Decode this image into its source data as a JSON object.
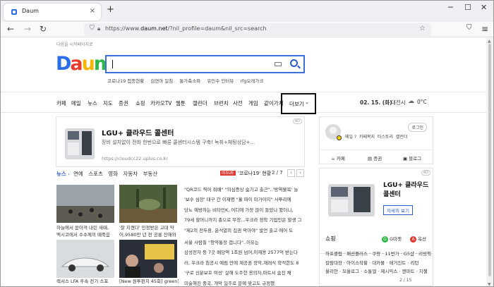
{
  "browser": {
    "tab_title": "Daum",
    "url_prefix": "https://www.",
    "url_domain": "daum.net",
    "url_path": "/?nil_profile=daum&nil_src=search"
  },
  "page": {
    "top_link": "다음을 시작페이지로",
    "logo": {
      "letters": [
        "D",
        "a",
        "u",
        "m"
      ],
      "colors": [
        "#2a6ee8",
        "#e83a2f",
        "#f5b400",
        "#2eb84a"
      ]
    },
    "search": {
      "placeholder": ""
    },
    "trends": [
      "코로나19 접종현황",
      "김연아 일침",
      "통가축소파",
      "유인수 인터뷰",
      "rfg오레가크"
    ],
    "menu": [
      "카페",
      "메일",
      "뉴스",
      "지도",
      "증권",
      "쇼핑",
      "카카오TV",
      "웹툰",
      "캘린더",
      "브런치",
      "사전",
      "게임",
      "같이가치",
      "더보기"
    ],
    "date": "02. 15. (화)",
    "region": "대전시",
    "temperature": "0°C"
  },
  "ad_main": {
    "tag": "AD",
    "title": "LGU+ 클라우드 콜센터",
    "desc": "장비 설치없이 전화 한번으로 빠른 콜센터시스템 구축! 녹취+채팅상담+...",
    "url": "https://cloudcc22.uplus.co.kr"
  },
  "news": {
    "tabs": [
      "뉴스",
      "연예",
      "스포츠",
      "영화",
      "자동차",
      "부동산"
    ],
    "issue_badge": "ISSUE",
    "issue_text": "'코로나19' 현황",
    "page": "2 / 7",
    "photos": [
      {
        "caption1": "하늘에서 쏟아져 내린 새떼,",
        "caption2": "멕시코에서 수수께끼 떼죽음"
      },
      {
        "caption1": "'잘 지켰다' 인정받은 고대 약",
        "caption2": "어,9580만 년 전 공룡 잔해와"
      },
      {
        "caption1": "렉서스 LFA 후속 전기 스포",
        "caption2": ""
      },
      {
        "caption1": "[New 원투펀치 45회] green]",
        "caption2": ""
      }
    ],
    "headlines": [
      "\"QR코드 찍어 줘배\" \"의심증상 숨기고 출근\"..'방역불복' 늘",
      "'보수 심장' 대구 간 이재명 \"홀 떠이 미가야지\" 사투리에",
      "당뇨 예방하는 비타민K, 어디에 가장 많이 들었나 봤더니,",
      "79세 할머니까지 총으로 무장...우크라 정착 기업인은 할생 그",
      "\"제2의 전두환, 윤석열의 집권 막아야\" 발언 출고 에어 도",
      "서울 사람들 \"청약통장 갭니다\"..이유는",
      "삼성전자 등 7곳 배당액 1조원 넘어,이재용 2577억 받는다",
      "러, 우크라 침공시 예림 만에 제공권 장악,재래식 학적한도 8",
      "'구로 신분보호 여성' 살해 도주한 용의자,마트서 숨진 채",
      "미술해진 중국, 개막 일주로 문예 맞고도 규정했"
    ]
  },
  "login": {
    "button": "로그인",
    "links": [
      "메일 ?",
      "카페목지",
      "티스토리",
      "캘린더"
    ],
    "services": [
      "카페",
      "증권",
      "블로그"
    ]
  },
  "ad_side": {
    "tag": "AD",
    "title1": "LGU+ 클라우드",
    "title2": "콜센터",
    "button": "자세히 보기"
  },
  "shopping": {
    "header": "쇼핑",
    "gmarket": "G마켓",
    "auction": "옥션",
    "items": [
      "하프클럽 · 패션플러스 · 쿠팡 · 11번가 · G5샵 · 리빙픽",
      "칼람대장 · 아이스작황 · 대카몰 · 매거진트 · 리턴",
      "올리안 · 모올로그 · 소통엘 · 제시믹스 · 캔마트 · 지첼"
    ],
    "page": "2 / 15"
  },
  "colors": {
    "accent": "#2a5ccc",
    "issue": "#e0382f",
    "border": "#e4e4e4"
  }
}
